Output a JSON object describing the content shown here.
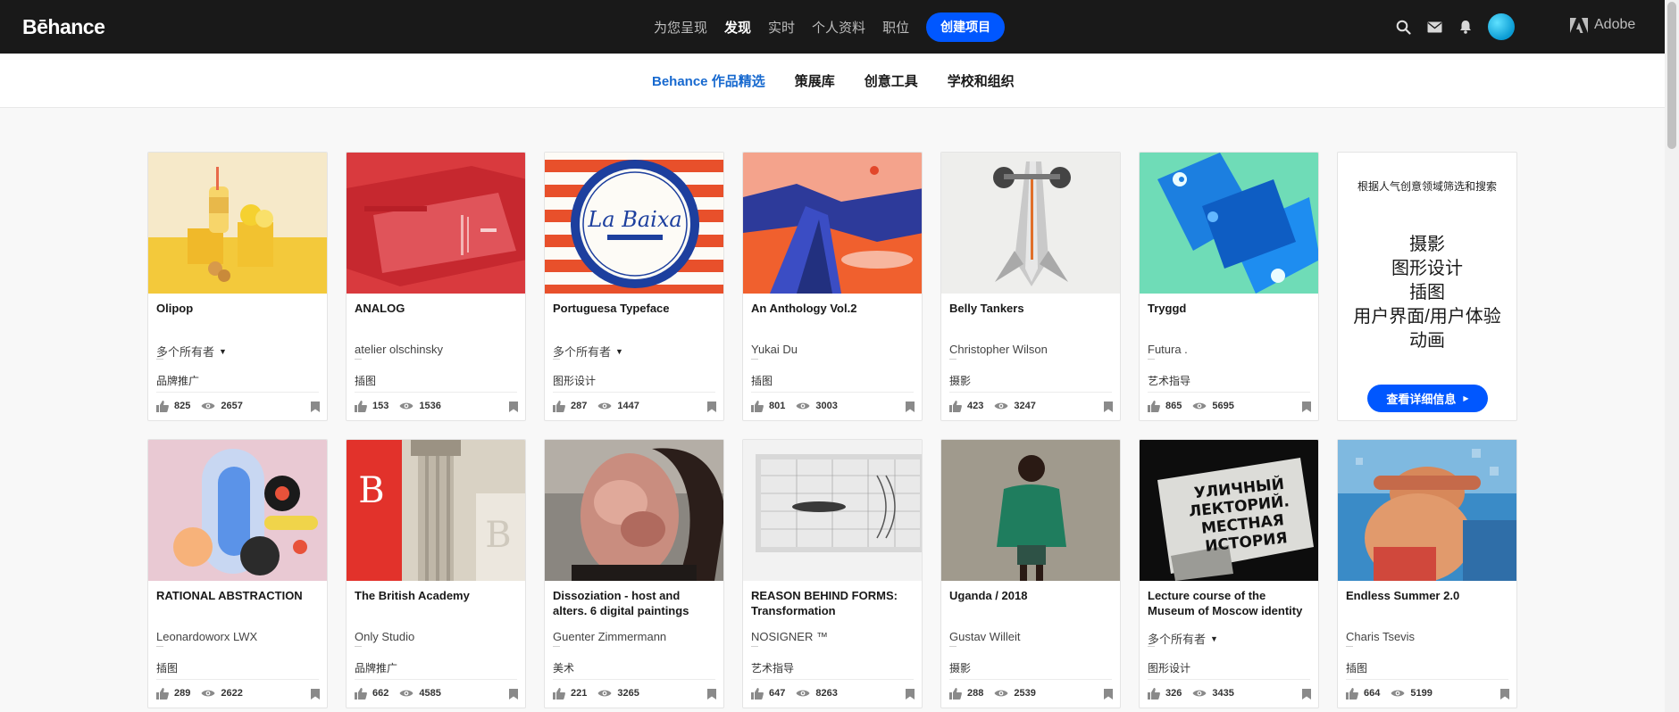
{
  "brand": {
    "logo": "Bēhance",
    "adobe": "Adobe"
  },
  "topnav": {
    "items": [
      {
        "label": "为您呈现",
        "active": false
      },
      {
        "label": "发现",
        "active": true
      },
      {
        "label": "实时",
        "active": false
      },
      {
        "label": "个人资料",
        "active": false
      },
      {
        "label": "职位",
        "active": false
      }
    ],
    "create_label": "创建项目",
    "icons": [
      "search-icon",
      "mail-icon",
      "bell-icon",
      "avatar"
    ]
  },
  "subnav": {
    "items": [
      {
        "label": "Behance 作品精选",
        "active": true
      },
      {
        "label": "策展库",
        "active": false
      },
      {
        "label": "创意工具",
        "active": false
      },
      {
        "label": "学校和组织",
        "active": false
      }
    ]
  },
  "colors": {
    "accent": "#0057ff",
    "active_subnav": "#1769cf",
    "topbar": "#191919"
  },
  "projects_row1": [
    {
      "title": "Olipop",
      "owner": "多个所有者",
      "multi": true,
      "field": "品牌推广",
      "likes": "825",
      "views": "2657",
      "cover": "olipop"
    },
    {
      "title": "ANALOG",
      "owner": "atelier olschinsky",
      "multi": false,
      "field": "插图",
      "likes": "153",
      "views": "1536",
      "cover": "analog"
    },
    {
      "title": "Portuguesa Typeface",
      "owner": "多个所有者",
      "multi": true,
      "field": "图形设计",
      "likes": "287",
      "views": "1447",
      "cover": "portuguesa"
    },
    {
      "title": "An Anthology Vol.2",
      "owner": "Yukai Du",
      "multi": false,
      "field": "插图",
      "likes": "801",
      "views": "3003",
      "cover": "anthology"
    },
    {
      "title": "Belly Tankers",
      "owner": "Christopher Wilson",
      "multi": false,
      "field": "摄影",
      "likes": "423",
      "views": "3247",
      "cover": "belly"
    },
    {
      "title": "Tryggd",
      "owner": "Futura .",
      "multi": false,
      "field": "艺术指导",
      "likes": "865",
      "views": "5695",
      "cover": "tryggd"
    }
  ],
  "cta": {
    "description": "根据人气创意领域筛选和搜索",
    "fields": [
      "摄影",
      "图形设计",
      "插图",
      "用户界面/用户体验",
      "动画"
    ],
    "button_label": "查看详细信息"
  },
  "projects_row2": [
    {
      "title": "RATIONAL ABSTRACTION",
      "owner": "Leonardoworx LWX",
      "multi": false,
      "field": "插图",
      "likes": "289",
      "views": "2622",
      "cover": "rational"
    },
    {
      "title": "The British Academy",
      "owner": "Only Studio",
      "multi": false,
      "field": "品牌推广",
      "likes": "662",
      "views": "4585",
      "cover": "british"
    },
    {
      "title": "Dissoziation - host and alters. 6 digital paintings",
      "owner": "Guenter Zimmermann",
      "multi": false,
      "field": "美术",
      "likes": "221",
      "views": "3265",
      "cover": "dissoziation"
    },
    {
      "title": "REASON BEHIND FORMS: Transformation",
      "owner": "NOSIGNER ™",
      "multi": false,
      "field": "艺术指导",
      "likes": "647",
      "views": "8263",
      "cover": "reason"
    },
    {
      "title": "Uganda / 2018",
      "owner": "Gustav Willeit",
      "multi": false,
      "field": "摄影",
      "likes": "288",
      "views": "2539",
      "cover": "uganda"
    },
    {
      "title": "Lecture course of the Museum of Moscow identity",
      "owner": "多个所有者",
      "multi": true,
      "field": "图形设计",
      "likes": "326",
      "views": "3435",
      "cover": "moscow",
      "cover_text": "УЛИЧНЫЙ ЛЕКТОРИЙ. МЕСТНАЯ ИСТОРИЯ"
    },
    {
      "title": "Endless Summer 2.0",
      "owner": "Charis Tsevis",
      "multi": false,
      "field": "插图",
      "likes": "664",
      "views": "5199",
      "cover": "summer"
    }
  ]
}
